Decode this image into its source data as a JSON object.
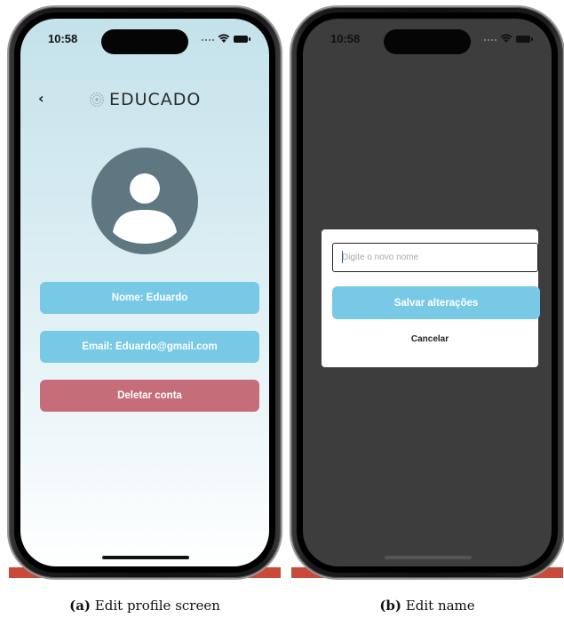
{
  "screen_a": {
    "status_bar": {
      "time": "10:58"
    },
    "header": {
      "back_icon": "chevron-left-icon",
      "logo_text": "EDUCADO"
    },
    "profile": {
      "avatar_icon": "user-icon",
      "name_button": "Nome: Eduardo",
      "email_button": "Email: Eduardo@gmail.com",
      "delete_button": "Deletar conta"
    }
  },
  "screen_b": {
    "status_bar": {
      "time": "10:58"
    },
    "dialog": {
      "input_placeholder": "Digite o novo nome",
      "save_button": "Salvar alterações",
      "cancel_button": "Cancelar"
    }
  },
  "captions": {
    "a_label": "(a)",
    "a_text": "Edit profile screen",
    "b_label": "(b)",
    "b_text": "Edit name"
  },
  "colors": {
    "primary_button": "#78c9e6",
    "delete_button": "#c66d7a",
    "avatar": "#5e7780",
    "overlay": "#3d3d3d"
  }
}
